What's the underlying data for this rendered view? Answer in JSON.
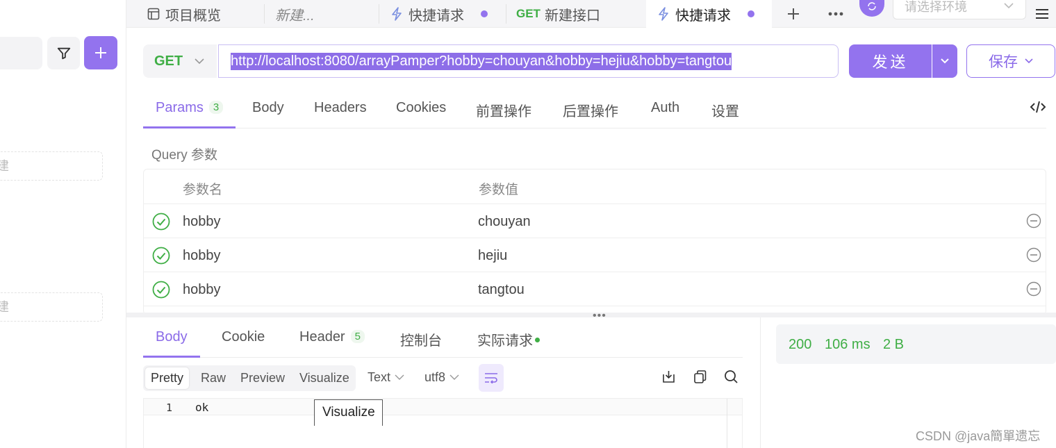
{
  "top_tabs": [
    {
      "label": "项目概览",
      "icon": "overview-icon"
    },
    {
      "label": "新建...",
      "icon": ""
    },
    {
      "label": "快捷请求",
      "icon": "lightning-icon"
    },
    {
      "label": "新建接口",
      "method": "GET"
    },
    {
      "label": "快捷请求",
      "icon": "lightning-icon"
    }
  ],
  "env_placeholder": "请选择环境",
  "sidebar": {
    "new_label_1": "建",
    "new_label_2": "建"
  },
  "request": {
    "method": "GET",
    "url": "http://localhost:8080/arrayPamper?hobby=chouyan&hobby=hejiu&hobby=tangtou",
    "send_label": "发送",
    "save_label": "保存"
  },
  "request_tabs": [
    {
      "label": "Params",
      "badge": "3"
    },
    {
      "label": "Body"
    },
    {
      "label": "Headers"
    },
    {
      "label": "Cookies"
    },
    {
      "label": "前置操作"
    },
    {
      "label": "后置操作"
    },
    {
      "label": "Auth"
    },
    {
      "label": "设置"
    }
  ],
  "query": {
    "title": "Query 参数",
    "col_name": "参数名",
    "col_value": "参数值",
    "rows": [
      {
        "name": "hobby",
        "value": "chouyan"
      },
      {
        "name": "hobby",
        "value": "hejiu"
      },
      {
        "name": "hobby",
        "value": "tangtou"
      }
    ]
  },
  "response_tabs": [
    {
      "label": "Body"
    },
    {
      "label": "Cookie"
    },
    {
      "label": "Header",
      "badge": "5"
    },
    {
      "label": "控制台"
    },
    {
      "label": "实际请求"
    }
  ],
  "view_modes": [
    "Pretty",
    "Raw",
    "Preview",
    "Visualize"
  ],
  "format": "Text",
  "encoding": "utf8",
  "body": {
    "line_number": "1",
    "content": "ok"
  },
  "tooltip": "Visualize",
  "status": {
    "code": "200",
    "time": "106 ms",
    "size": "2 B"
  },
  "watermark": "CSDN @java簡單遗忘",
  "colors": {
    "accent": "#9373ee",
    "get": "#3fae45"
  }
}
